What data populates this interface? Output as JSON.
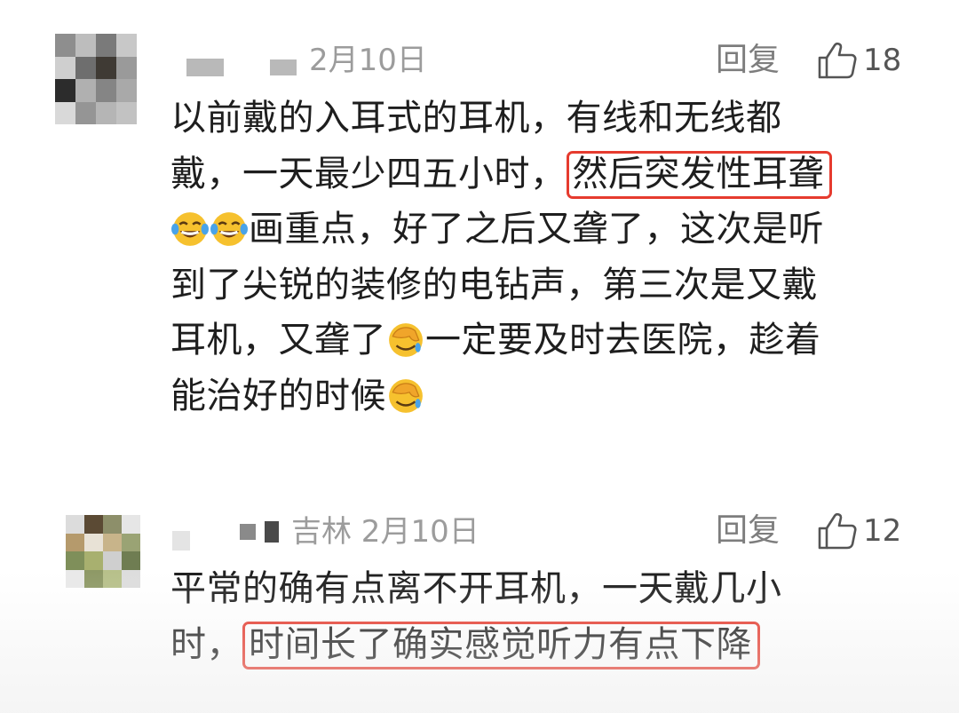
{
  "comments": [
    {
      "meta": "2月10日",
      "reply_label": "回复",
      "likes": "18",
      "lines": {
        "l1": "以前戴的入耳式的耳机，有线和无线都",
        "l2a": "戴，一天最少四五小时，",
        "l2hl": "然后突发性耳聋",
        "l3": "画重点，好了之后又聋了，这次是听",
        "l4": "到了尖锐的装修的电钻声，第三次是又戴",
        "l5a": "耳机，又聋了",
        "l5b": "一定要及时去医院，趁着",
        "l6": "能治好的时候"
      }
    },
    {
      "meta": "吉林  2月10日",
      "reply_label": "回复",
      "likes": "12",
      "lines": {
        "l1": "平常的确有点离不开耳机，一天戴几小",
        "l2a": "时，",
        "l2hl": "时间长了确实感觉听力有点下降"
      }
    }
  ],
  "icons": {
    "like": "thumbs-up-icon",
    "laugh": "tears-of-joy-emoji",
    "facepalm": "facepalm-emoji"
  },
  "colors": {
    "highlight_border": "#e63b2e",
    "meta_text": "#9c9c9c",
    "body_text": "#1e1e1e"
  }
}
